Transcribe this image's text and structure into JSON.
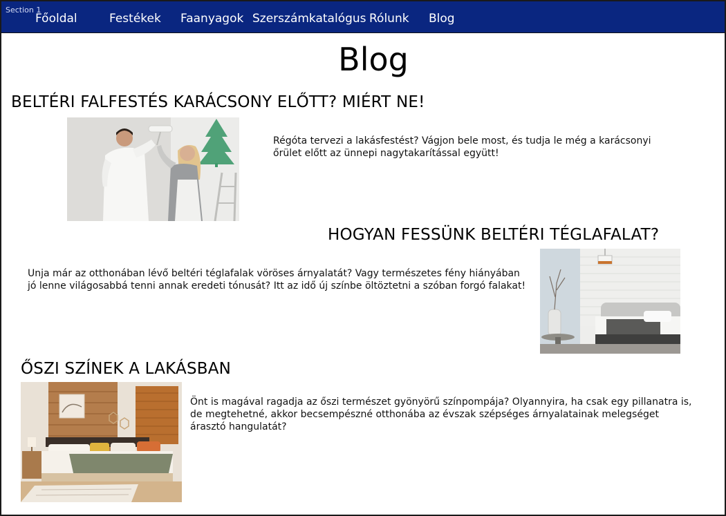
{
  "frame": {
    "label": "Section 1"
  },
  "nav": {
    "items": [
      "Főoldal",
      "Festékek",
      "Faanyagok",
      "Szerszámkatalógus",
      "Rólunk",
      "Blog"
    ]
  },
  "page": {
    "title": "Blog"
  },
  "posts": [
    {
      "title": "BELTÉRI FALFESTÉS KARÁCSONY ELŐTT? MIÉRT NE!",
      "excerpt": "Régóta tervezi a lakásfestést? Vágjon bele most, és tudja le még a karácsonyi őrület előtt az ünnepi nagytakarítással együtt!",
      "image": "couple-painting-wall-photo"
    },
    {
      "title": "HOGYAN FESSÜNK BELTÉRI TÉGLAFALAT?",
      "excerpt": "Unja már az otthonában lévő beltéri téglafalak vöröses árnyalatát? Vagy természetes fény hiányában jó lenne világosabbá tenni annak eredeti tónusát? Itt az idő új színbe öltöztetni a szóban forgó falakat!",
      "image": "white-brick-bedroom-photo"
    },
    {
      "title": "ŐSZI SZÍNEK A LAKÁSBAN",
      "excerpt": "Önt is magával ragadja az őszi természet gyönyörű színpompája? Olyannyira, ha csak egy pillanatra is, de megtehetné, akkor becsempészné otthonába az évszak szépséges árnyalatainak melegséget árasztó hangulatát?",
      "image": "autumn-bedroom-photo"
    }
  ]
}
